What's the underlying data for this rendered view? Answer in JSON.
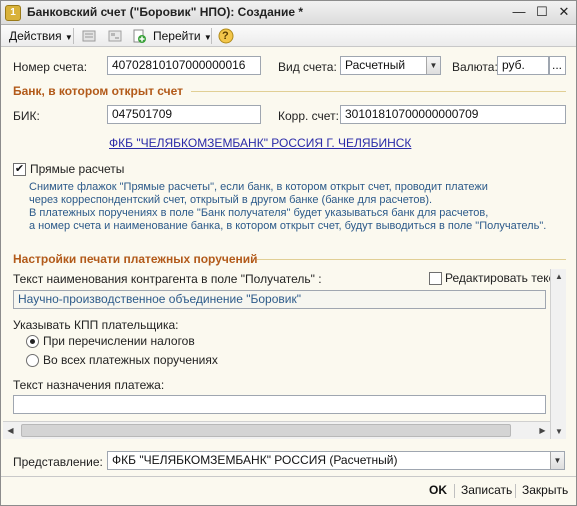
{
  "window": {
    "title": "Банковский счет (\"Боровик\" НПО): Создание *",
    "minimize_glyph": "—",
    "maximize_glyph": "☐",
    "close_glyph": "✕"
  },
  "toolbar": {
    "actions_label": "Действия",
    "goto_label": "Перейти",
    "help_glyph": "?"
  },
  "account": {
    "number_label": "Номер счета:",
    "number_value": "40702810107000000016",
    "type_label": "Вид счета:",
    "type_value": "Расчетный",
    "currency_label": "Валюта:",
    "currency_value": "руб.",
    "currency_select_glyph": "..."
  },
  "bank": {
    "section_title": "Банк, в котором открыт счет",
    "bik_label": "БИК:",
    "bik_value": "047501709",
    "corr_label": "Корр. счет:",
    "corr_value": "30101810700000000709",
    "bank_name_link": "ФКБ \"ЧЕЛЯБКОМЗЕМБАНК\" РОССИЯ Г. ЧЕЛЯБИНСК"
  },
  "direct": {
    "checkbox_label": "Прямые расчеты",
    "checked": true,
    "hint_lines": [
      "Снимите флажок \"Прямые расчеты\", если банк, в котором открыт счет, проводит платежи",
      "через корреспондентский счет, открытый в другом банке (банке для расчетов).",
      "В платежных поручениях в поле \"Банк получателя\" будет указываться банк для расчетов,",
      "а номер счета и наименование банка, в котором открыт счет, будут выводиться в поле \"Получатель\"."
    ]
  },
  "print": {
    "section_title": "Настройки печати платежных поручений",
    "recipient_text_label": "Текст наименования контрагента в поле \"Получатель\" :",
    "edit_checkbox_label": "Редактировать текст",
    "edit_checked": false,
    "recipient_text_value": "Научно-производственное объединение \"Боровик\"",
    "kpp_label": "Указывать КПП плательщика:",
    "radio_taxes_label": "При перечислении налогов",
    "radio_all_label": "Во всех платежных поручениях",
    "selected_radio": "taxes",
    "purpose_label": "Текст назначения платежа:",
    "purpose_value": ""
  },
  "presentation": {
    "label": "Представление:",
    "value": "ФКБ \"ЧЕЛЯБКОМЗЕМБАНК\"  РОССИЯ (Расчетный)"
  },
  "footer": {
    "ok_label": "OK",
    "save_label": "Записать",
    "close_label": "Закрыть"
  }
}
